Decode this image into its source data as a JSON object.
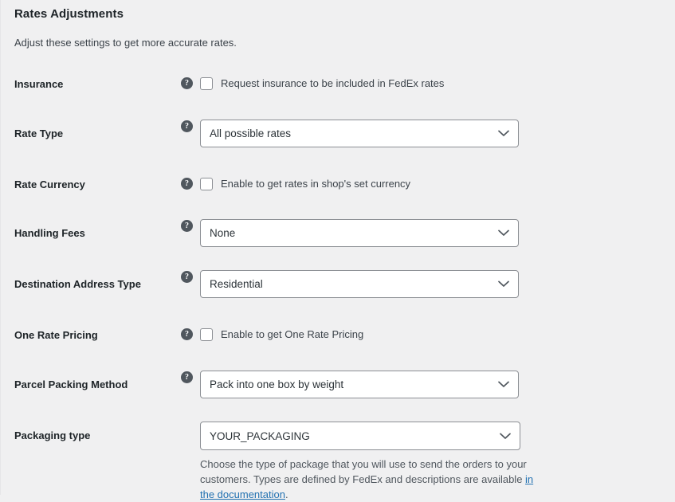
{
  "section": {
    "title": "Rates Adjustments",
    "description": "Adjust these settings to get more accurate rates."
  },
  "icons": {
    "help": "help-icon",
    "chevron": "chevron-down-icon"
  },
  "rows": [
    {
      "label": "Insurance",
      "type": "checkbox",
      "has_help": true,
      "checkbox_label": "Request insurance to be included in FedEx rates",
      "checked": false
    },
    {
      "label": "Rate Type",
      "type": "select",
      "has_help": true,
      "value": "All possible rates"
    },
    {
      "label": "Rate Currency",
      "type": "checkbox",
      "has_help": true,
      "checkbox_label": "Enable to get rates in shop's set currency",
      "checked": false
    },
    {
      "label": "Handling Fees",
      "type": "select",
      "has_help": true,
      "value": "None"
    },
    {
      "label": "Destination Address Type",
      "type": "select",
      "has_help": true,
      "value": "Residential"
    },
    {
      "label": "One Rate Pricing",
      "type": "checkbox",
      "has_help": true,
      "checkbox_label": "Enable to get One Rate Pricing",
      "checked": false
    },
    {
      "label": "Parcel Packing Method",
      "type": "select",
      "has_help": true,
      "value": "Pack into one box by weight"
    },
    {
      "label": "Packaging type",
      "type": "select",
      "has_help": false,
      "value": "YOUR_PACKAGING",
      "description_before": "Choose the type of package that you will use to send the orders to your customers. Types are defined by FedEx and descriptions are available ",
      "description_link": "in the documentation",
      "description_after": "."
    }
  ],
  "colors": {
    "page_background": "#f0f0f1",
    "label_text": "#1d2327",
    "body_text": "#3c434a",
    "muted_text": "#50575e",
    "link": "#2271b1",
    "field_border": "#8c8f94",
    "field_background": "#ffffff",
    "help_icon_background": "#50575e"
  }
}
